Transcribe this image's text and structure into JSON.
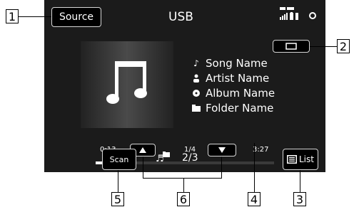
{
  "header": {
    "title": "USB",
    "source_label": "Source"
  },
  "status_icons": [
    "tel-signal-icon",
    "battery-icon",
    "bluetooth-icon",
    "info-icon"
  ],
  "track": {
    "song": "Song Name",
    "artist": "Artist Name",
    "album": "Album Name",
    "folder": "Folder Name",
    "elapsed": "0:13",
    "duration": "3:27",
    "folder_position": "1/4",
    "track_position": "2/3",
    "progress_fraction": 0.063
  },
  "controls": {
    "scan_label": "Scan",
    "list_label": "List"
  },
  "callouts": [
    "1",
    "2",
    "3",
    "4",
    "5",
    "6"
  ],
  "colors": {
    "screen_bg": "#1b1b1b",
    "button_border": "#d8d8d8",
    "text": "#ffffff"
  }
}
